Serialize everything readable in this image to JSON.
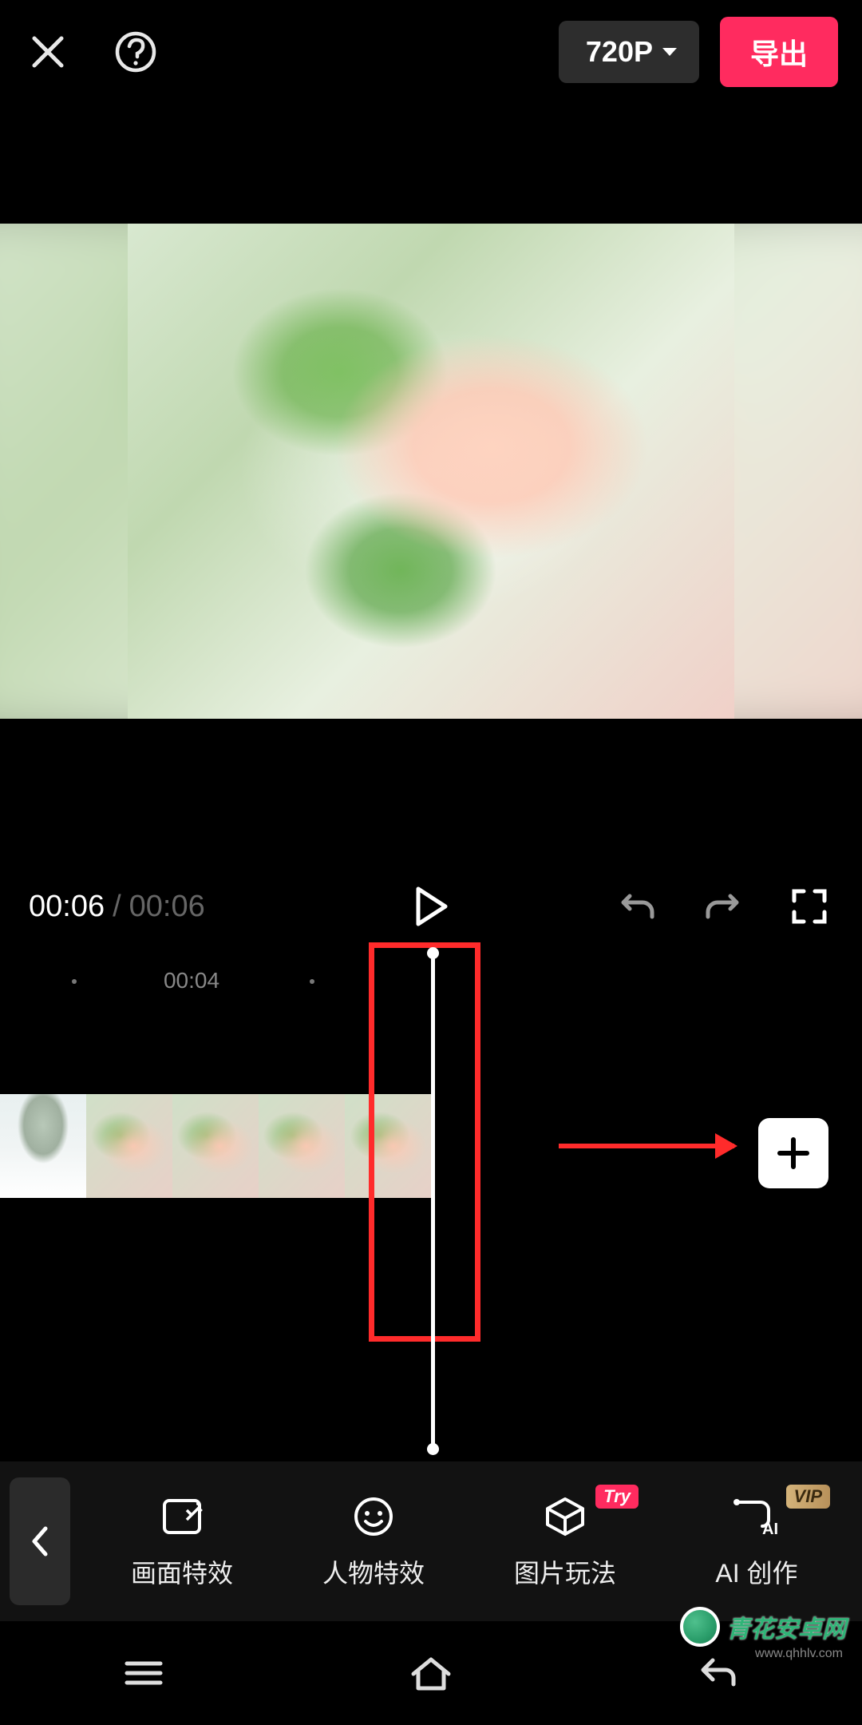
{
  "topbar": {
    "resolution_label": "720P",
    "export_label": "导出"
  },
  "playback": {
    "current_time": "00:06",
    "separator": "/",
    "total_time": "00:06"
  },
  "timeline": {
    "ruler_label": "00:04"
  },
  "toolbar": {
    "items": [
      {
        "label": "画面特效",
        "badge": null
      },
      {
        "label": "人物特效",
        "badge": null
      },
      {
        "label": "图片玩法",
        "badge": "Try",
        "badge_type": "try"
      },
      {
        "label": "AI 创作",
        "badge": "VIP",
        "badge_type": "vip"
      }
    ]
  },
  "watermark": {
    "name": "青花安卓网",
    "url": "www.qhhlv.com"
  },
  "colors": {
    "accent": "#ff2b5f",
    "highlight_box": "#ff2b2b",
    "vip_gradient_from": "#d4b37a",
    "vip_gradient_to": "#b8915a"
  }
}
